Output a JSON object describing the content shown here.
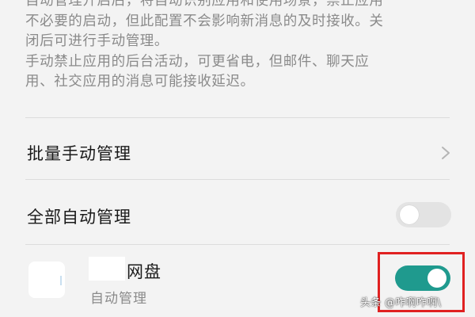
{
  "description": {
    "lines": [
      "自动管理开启后，将自动识别应用和使用场景，禁止应用",
      "不必要的启动，但此配置不会影响新消息的及时接收。关",
      "闭后可进行手动管理。",
      "手动禁止应用的后台活动，可更省电，但邮件、聊天应",
      "用、社交应用的消息可能接收延迟。"
    ]
  },
  "rows": {
    "batch_manual": {
      "label": "批量手动管理",
      "icon": "chevron-right-icon"
    },
    "all_auto": {
      "label": "全部自动管理",
      "toggle": "off"
    }
  },
  "app": {
    "name": "网盘",
    "status": "自动管理",
    "toggle": "on",
    "toggle_color": "#1f9a8e"
  },
  "highlight_color": "#e02121",
  "watermark": "头条 @咋啊咋啊\\"
}
